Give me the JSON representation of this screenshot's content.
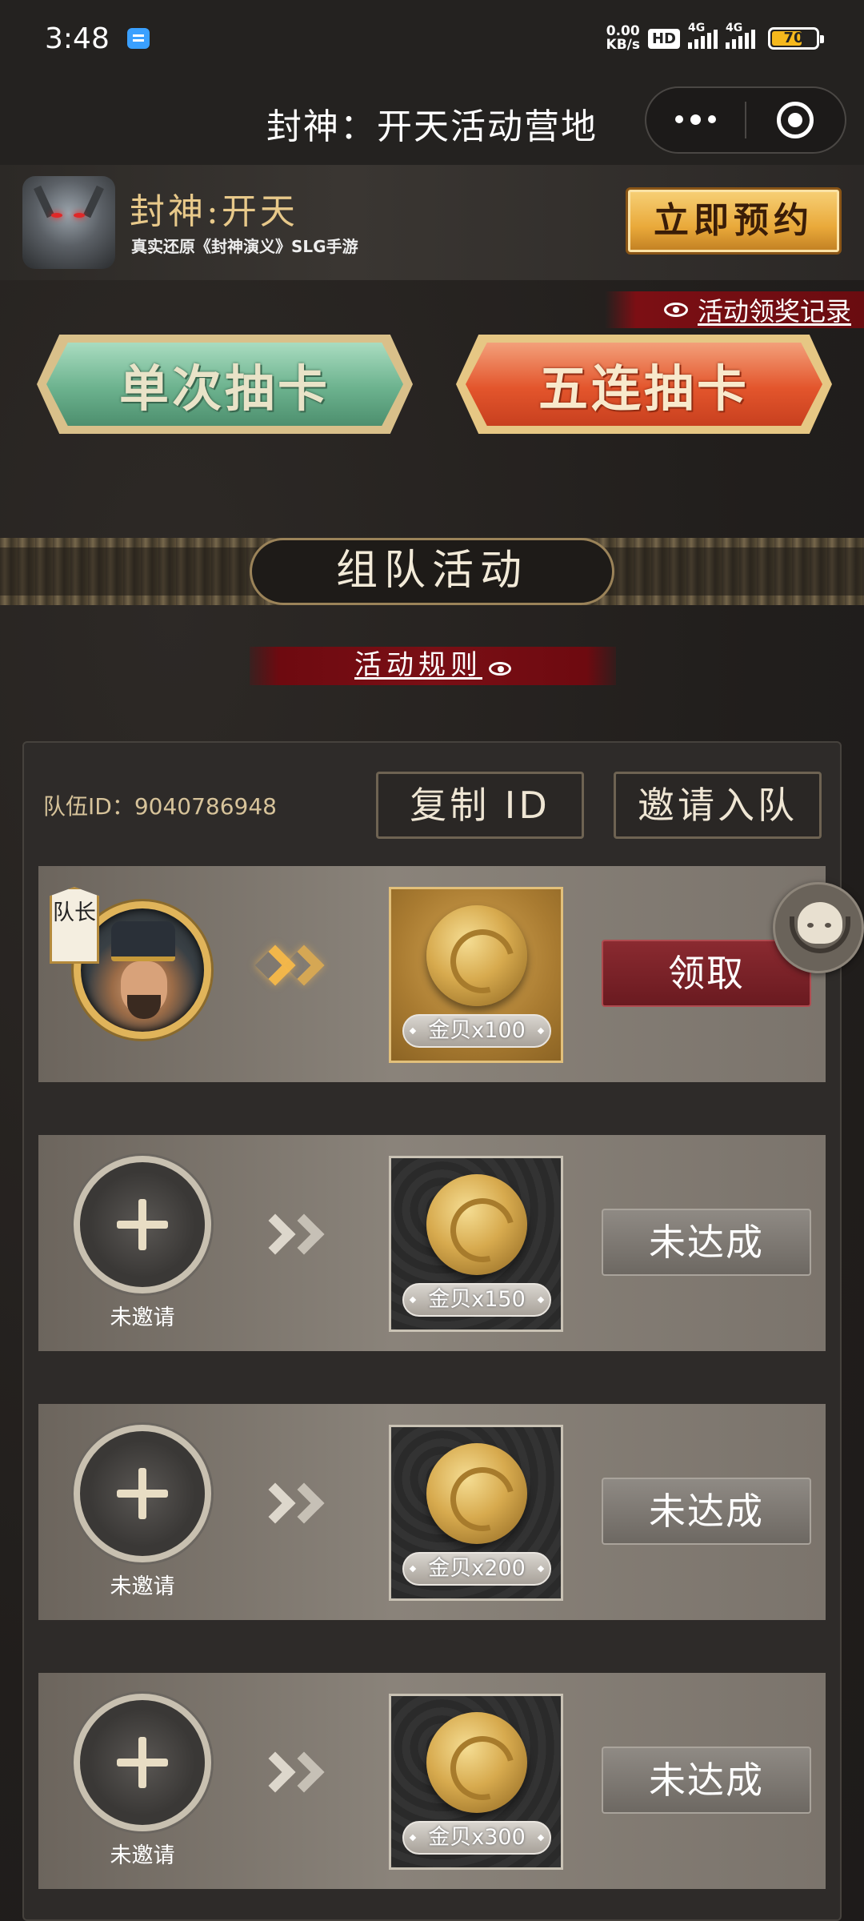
{
  "status_bar": {
    "time": "3:48",
    "net_speed_value": "0.00",
    "net_speed_unit": "KB/s",
    "hd_badge": "HD",
    "signal1_label": "4G",
    "signal2_label": "4G",
    "battery": "70",
    "battery_fraction": 0.7
  },
  "title_bar": {
    "title": "封神：开天活动营地",
    "icons": [
      "more-icon",
      "target-icon"
    ]
  },
  "banner": {
    "game_name": "封神:开天",
    "game_subtitle": "真实还原《封神演义》SLG手游",
    "reserve_label": "立即预约"
  },
  "activity": {
    "record_link": "活动领奖记录",
    "single_draw": "单次抽卡",
    "five_draw": "五连抽卡",
    "team_title": "组队活动",
    "rules_link": "活动规则"
  },
  "team": {
    "team_id_text": "队伍ID：9040786948",
    "copy_id_label": "复制 ID",
    "invite_label": "邀请入队",
    "leader_badge": "队长",
    "rows": [
      {
        "slot_label": "",
        "reward": "金贝x100",
        "state": "领取"
      },
      {
        "slot_label": "未邀请",
        "reward": "金贝x150",
        "state": "未达成"
      },
      {
        "slot_label": "未邀请",
        "reward": "金贝x200",
        "state": "未达成"
      },
      {
        "slot_label": "未邀请",
        "reward": "金贝x300",
        "state": "未达成"
      }
    ]
  },
  "colors": {
    "accent_gold": "#e0b45a",
    "claim_red": "#8a2a30",
    "background": "#1f1c1b"
  }
}
